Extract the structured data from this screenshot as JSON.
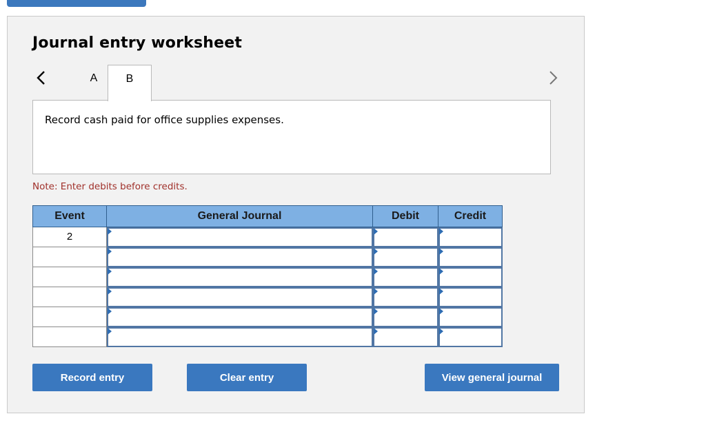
{
  "worksheet": {
    "title": "Journal entry worksheet",
    "tabs": [
      {
        "label": "A"
      },
      {
        "label": "B",
        "active": true
      }
    ],
    "prompt": "Record cash paid for office supplies expenses.",
    "note": "Note: Enter debits before credits."
  },
  "table": {
    "headers": {
      "event": "Event",
      "account": "General Journal",
      "debit": "Debit",
      "credit": "Credit"
    },
    "rows": [
      {
        "event": "2",
        "account": "",
        "debit": "",
        "credit": ""
      },
      {
        "event": "",
        "account": "",
        "debit": "",
        "credit": ""
      },
      {
        "event": "",
        "account": "",
        "debit": "",
        "credit": ""
      },
      {
        "event": "",
        "account": "",
        "debit": "",
        "credit": ""
      },
      {
        "event": "",
        "account": "",
        "debit": "",
        "credit": ""
      },
      {
        "event": "",
        "account": "",
        "debit": "",
        "credit": ""
      }
    ]
  },
  "buttons": {
    "record": "Record entry",
    "clear": "Clear entry",
    "view": "View general journal"
  },
  "colors": {
    "accent": "#3a78bf",
    "header_bg": "#7eb0e3",
    "note": "#a0302a",
    "panel_bg": "#f2f2f2"
  },
  "icons": {
    "prev": "chevron-left-icon",
    "next": "chevron-right-icon",
    "dropdown_marker": "triangle-right-icon"
  }
}
